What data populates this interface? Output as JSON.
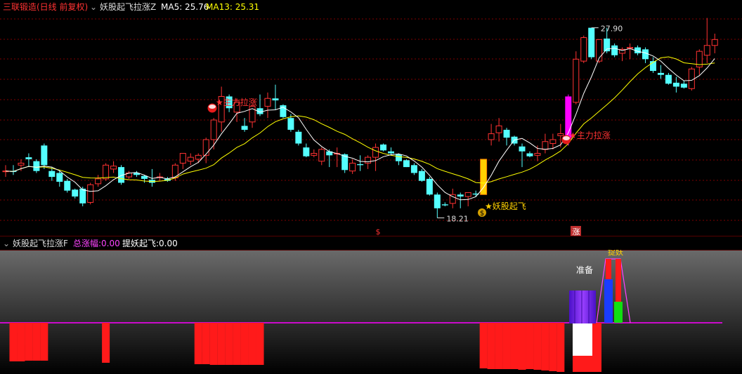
{
  "top_header": {
    "stock": "三联锻造",
    "period": "(日线 前复权)",
    "indicator": "妖股起飞拉涨Z",
    "ma5_label": "MA5: 25.76",
    "ma13_label": "MA13: 25.31"
  },
  "bottom_header": {
    "indicator": "妖股起飞拉涨F",
    "total_gain_key": "总涨幅:",
    "total_gain_val": "0.00",
    "catch_key": "提妖起飞:",
    "catch_val": "0.00"
  },
  "colors": {
    "up": "#ff3232",
    "down": "#54ffff",
    "ma5": "#ffffff",
    "ma13": "#ffff00",
    "grid": "#800000",
    "signal": "#ffd000",
    "magenta": "#ff00ff"
  },
  "annotations": {
    "high_label": "27.90",
    "low_label": "18.21",
    "main_pull_1": "★主力拉涨",
    "main_pull_2": "★主力拉涨",
    "takeoff": "★妖股起飞",
    "marker_s": "$",
    "marker_zhang": "涨",
    "ready": "准备",
    "catch": "捉妖"
  },
  "chart_data": [
    {
      "type": "candlestick",
      "title": "妖股起飞拉涨Z",
      "series": [
        {
          "name": "MA5",
          "last": 25.76
        },
        {
          "name": "MA13",
          "last": 25.31
        }
      ],
      "ohlc": [
        [
          20.6,
          20.9,
          20.3,
          20.6
        ],
        [
          20.6,
          20.9,
          20.4,
          20.55
        ],
        [
          20.9,
          21.2,
          20.6,
          21.0
        ],
        [
          21.3,
          21.5,
          20.8,
          21.2
        ],
        [
          21.1,
          21.2,
          20.5,
          20.6
        ],
        [
          21.9,
          22.0,
          20.7,
          20.9
        ],
        [
          20.6,
          20.8,
          20.1,
          20.3
        ],
        [
          20.5,
          20.6,
          19.8,
          20.05
        ],
        [
          20.1,
          20.2,
          19.5,
          19.6
        ],
        [
          19.65,
          19.7,
          19.2,
          19.3
        ],
        [
          19.7,
          19.8,
          18.8,
          18.95
        ],
        [
          19.0,
          20.0,
          18.9,
          19.9
        ],
        [
          19.95,
          20.4,
          19.8,
          20.2
        ],
        [
          20.2,
          21.0,
          20.1,
          20.9
        ],
        [
          20.7,
          21.1,
          20.5,
          20.85
        ],
        [
          20.8,
          20.9,
          19.9,
          20.0
        ],
        [
          20.3,
          20.6,
          20.2,
          20.5
        ],
        [
          20.5,
          20.6,
          20.3,
          20.4
        ],
        [
          20.35,
          20.4,
          20.0,
          20.2
        ],
        [
          20.15,
          20.7,
          19.8,
          20.0
        ],
        [
          20.3,
          20.5,
          20.1,
          20.3
        ],
        [
          20.2,
          20.3,
          20.05,
          20.1
        ],
        [
          20.25,
          21.0,
          20.1,
          20.9
        ],
        [
          21.0,
          21.5,
          20.7,
          21.5
        ],
        [
          21.1,
          21.5,
          20.9,
          21.3
        ],
        [
          21.2,
          21.5,
          21.0,
          21.4
        ],
        [
          21.4,
          22.3,
          21.0,
          22.2
        ],
        [
          22.2,
          23.3,
          21.7,
          23.2
        ],
        [
          23.1,
          24.9,
          22.6,
          24.4
        ],
        [
          24.4,
          24.5,
          23.6,
          23.8
        ],
        [
          23.6,
          24.3,
          23.1,
          24.1
        ],
        [
          22.9,
          23.3,
          22.6,
          22.7
        ],
        [
          23.1,
          24.0,
          22.8,
          23.9
        ],
        [
          23.8,
          24.5,
          23.4,
          23.5
        ],
        [
          23.9,
          24.6,
          23.3,
          24.3
        ],
        [
          24.3,
          25.0,
          23.7,
          24.2
        ],
        [
          23.95,
          24.0,
          23.3,
          23.35
        ],
        [
          23.3,
          23.5,
          22.6,
          22.7
        ],
        [
          22.6,
          22.7,
          21.9,
          22.0
        ],
        [
          21.8,
          22.0,
          21.3,
          21.35
        ],
        [
          21.4,
          21.7,
          21.3,
          21.5
        ],
        [
          21.1,
          21.8,
          20.9,
          21.7
        ],
        [
          21.6,
          21.7,
          20.8,
          21.4
        ],
        [
          21.5,
          21.8,
          20.8,
          21.5
        ],
        [
          21.45,
          21.5,
          20.5,
          20.65
        ],
        [
          20.6,
          21.2,
          20.45,
          21.0
        ],
        [
          20.95,
          21.4,
          20.6,
          20.9
        ],
        [
          21.0,
          21.4,
          20.7,
          21.3
        ],
        [
          21.3,
          22.0,
          20.6,
          21.8
        ],
        [
          21.95,
          22.0,
          21.6,
          21.65
        ],
        [
          21.6,
          21.8,
          21.4,
          21.5
        ],
        [
          21.45,
          21.5,
          20.9,
          21.1
        ],
        [
          21.15,
          21.2,
          20.8,
          20.8
        ],
        [
          20.9,
          21.0,
          20.4,
          20.5
        ],
        [
          20.6,
          20.7,
          20.05,
          20.1
        ],
        [
          20.2,
          20.3,
          19.35,
          19.4
        ],
        [
          19.4,
          19.5,
          18.21,
          18.7
        ],
        [
          18.9,
          19.0,
          18.8,
          18.85
        ],
        [
          18.95,
          19.7,
          18.7,
          19.4
        ],
        [
          19.4,
          19.5,
          18.7,
          19.3
        ],
        [
          19.3,
          19.5,
          18.8,
          19.5
        ],
        [
          19.45,
          19.6,
          19.3,
          19.4
        ],
        [
          19.4,
          21.2,
          19.4,
          21.2
        ],
        [
          22.2,
          23.0,
          21.9,
          22.5
        ],
        [
          22.55,
          23.3,
          22.1,
          22.9
        ],
        [
          22.7,
          22.8,
          21.9,
          22.3
        ],
        [
          22.35,
          22.4,
          21.9,
          22.0
        ],
        [
          21.85,
          22.0,
          20.8,
          21.6
        ],
        [
          21.5,
          21.6,
          21.3,
          21.35
        ],
        [
          21.4,
          21.9,
          21.1,
          21.5
        ],
        [
          21.7,
          22.5,
          21.5,
          22.1
        ],
        [
          22.0,
          22.5,
          21.7,
          22.2
        ],
        [
          22.4,
          23.0,
          21.8,
          22.5
        ],
        [
          22.2,
          24.5,
          21.9,
          24.4
        ],
        [
          24.1,
          26.7,
          24.0,
          26.3
        ],
        [
          26.2,
          27.5,
          26.1,
          27.4
        ],
        [
          27.9,
          27.9,
          26.3,
          26.4
        ],
        [
          26.2,
          27.3,
          26.1,
          27.3
        ],
        [
          27.35,
          27.9,
          26.6,
          26.7
        ],
        [
          27.0,
          27.1,
          26.4,
          26.5
        ],
        [
          26.6,
          26.9,
          26.2,
          26.8
        ],
        [
          26.85,
          27.1,
          26.3,
          26.9
        ],
        [
          26.9,
          27.0,
          26.5,
          26.6
        ],
        [
          26.8,
          26.9,
          26.1,
          26.3
        ],
        [
          26.2,
          26.4,
          25.6,
          25.7
        ],
        [
          25.6,
          26.0,
          25.3,
          25.5
        ],
        [
          25.5,
          25.6,
          25.0,
          25.05
        ],
        [
          25.1,
          25.4,
          24.6,
          24.9
        ],
        [
          25.05,
          25.2,
          24.8,
          24.85
        ],
        [
          24.8,
          25.9,
          24.7,
          25.8
        ],
        [
          25.9,
          26.8,
          25.5,
          26.7
        ],
        [
          26.5,
          28.4,
          26.1,
          27.0
        ],
        [
          27.0,
          27.6,
          26.6,
          27.3
        ]
      ],
      "ylim": [
        17.8,
        28.6
      ],
      "y_high": 27.9,
      "y_low": 18.21
    },
    {
      "type": "bar",
      "title": "妖股起飞拉涨F",
      "series": [
        {
          "name": "总涨幅",
          "last": 0.0
        },
        {
          "name": "提妖起飞",
          "last": 0.0
        }
      ]
    }
  ]
}
